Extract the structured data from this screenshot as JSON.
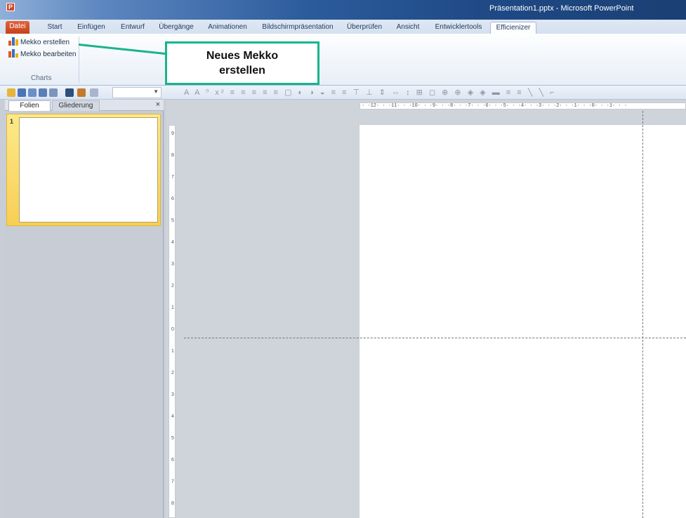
{
  "window": {
    "title": "Präsentation1.pptx - Microsoft PowerPoint",
    "app_icon_letter": "P"
  },
  "ribbon_tabs": [
    {
      "label": "Datei"
    },
    {
      "label": "Start"
    },
    {
      "label": "Einfügen"
    },
    {
      "label": "Entwurf"
    },
    {
      "label": "Übergänge"
    },
    {
      "label": "Animationen"
    },
    {
      "label": "Bildschirmpräsentation"
    },
    {
      "label": "Überprüfen"
    },
    {
      "label": "Ansicht"
    },
    {
      "label": "Entwicklertools"
    },
    {
      "label": "Efficienizer"
    }
  ],
  "active_tab": "Efficienizer",
  "ribbon": {
    "items": [
      {
        "label": "Mekko erstellen",
        "icon": "mekko-chart-icon"
      },
      {
        "label": "Mekko bearbeiten",
        "icon": "mekko-edit-icon"
      }
    ],
    "group_label": "Charts"
  },
  "callout": {
    "line1": "Neues Mekko",
    "line2": "erstellen"
  },
  "panel": {
    "tabs": [
      "Folien",
      "Gliederung"
    ],
    "close": "×",
    "slides": [
      {
        "number": "1"
      }
    ]
  },
  "ruler": {
    "horizontal": "· ·12· · ·11· · ·10· · ·9· · ·8· · ·7· · ·6· · ·5· · ·4· · ·3· · ·2· · ·1· · ·0· · ·1· · ·",
    "vertical": [
      "9",
      "8",
      "7",
      "6",
      "5",
      "4",
      "3",
      "2",
      "1",
      "0",
      "1",
      "2",
      "3",
      "4",
      "5",
      "6",
      "7",
      "8"
    ]
  },
  "colors": {
    "callout_border": "#19b48a",
    "file_tab": "#d24726",
    "slide_selected": "#f7cf55"
  }
}
